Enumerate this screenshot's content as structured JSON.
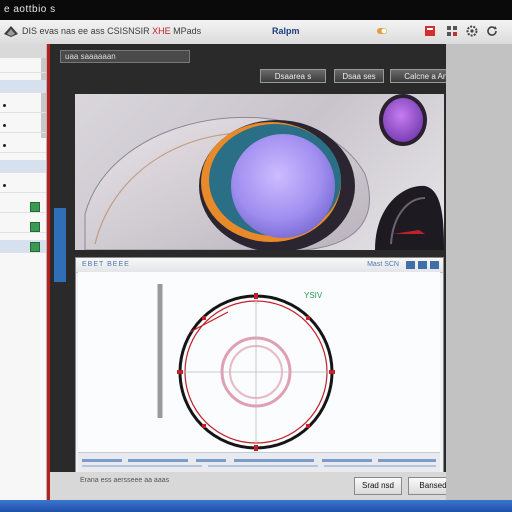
{
  "window": {
    "title": "e  aottbio s"
  },
  "menubar": {
    "path_prefix": "DIS",
    "path_text": "evas nas ee ass CSISNSIR",
    "path_highlight": "XHE",
    "path_suffix": "MPads",
    "mode_label": "Ralpm",
    "icons": [
      "toggle-icon",
      "pdf-icon",
      "grid-icon",
      "cog-icon",
      "refresh-icon"
    ]
  },
  "leftpanel": {
    "rows": [
      {
        "selected": false,
        "bullet": false,
        "check": false
      },
      {
        "selected": true,
        "bullet": false,
        "check": false
      },
      {
        "selected": false,
        "bullet": true,
        "check": false
      },
      {
        "selected": false,
        "bullet": true,
        "check": false
      },
      {
        "selected": false,
        "bullet": true,
        "check": false
      },
      {
        "selected": true,
        "bullet": false,
        "check": false
      },
      {
        "selected": false,
        "bullet": true,
        "check": false
      },
      {
        "selected": false,
        "bullet": false,
        "check": true
      },
      {
        "selected": false,
        "bullet": false,
        "check": true
      },
      {
        "selected": true,
        "bullet": false,
        "check": true
      }
    ]
  },
  "mainwin": {
    "title": "uaa saaaaaan",
    "buttons": [
      "Dsaarea s",
      "Dsaa ses",
      "Calcne a Anties"
    ]
  },
  "lower_panel": {
    "header_left": "EBET BEEE",
    "header_right": "Mast SCN",
    "plot_label": "YSIV"
  },
  "bottom": {
    "note": "Erana ess aersseee aa aaas",
    "cancel_label": "Srad nsd",
    "ok_label": "Bansed"
  },
  "colors": {
    "accent_red": "#c0202a",
    "accent_blue": "#2e6fb8",
    "circle_fill": "#b59cf2",
    "ring_orange": "#e88a2a"
  }
}
